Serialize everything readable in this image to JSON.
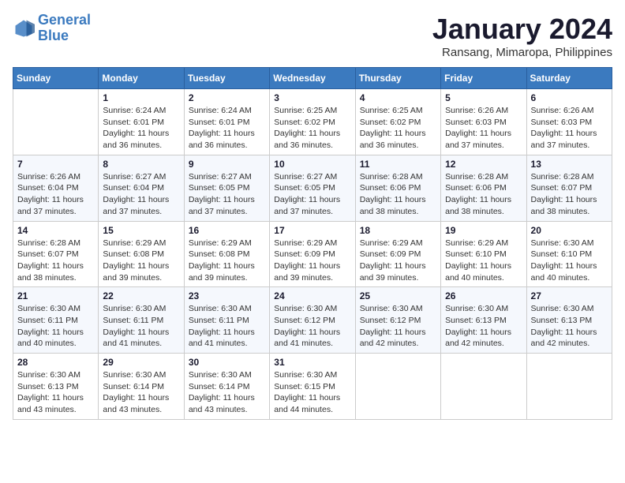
{
  "header": {
    "logo_line1": "General",
    "logo_line2": "Blue",
    "month": "January 2024",
    "location": "Ransang, Mimaropa, Philippines"
  },
  "weekdays": [
    "Sunday",
    "Monday",
    "Tuesday",
    "Wednesday",
    "Thursday",
    "Friday",
    "Saturday"
  ],
  "weeks": [
    [
      {
        "day": "",
        "sunrise": "",
        "sunset": "",
        "daylight": ""
      },
      {
        "day": "1",
        "sunrise": "Sunrise: 6:24 AM",
        "sunset": "Sunset: 6:01 PM",
        "daylight": "Daylight: 11 hours and 36 minutes."
      },
      {
        "day": "2",
        "sunrise": "Sunrise: 6:24 AM",
        "sunset": "Sunset: 6:01 PM",
        "daylight": "Daylight: 11 hours and 36 minutes."
      },
      {
        "day": "3",
        "sunrise": "Sunrise: 6:25 AM",
        "sunset": "Sunset: 6:02 PM",
        "daylight": "Daylight: 11 hours and 36 minutes."
      },
      {
        "day": "4",
        "sunrise": "Sunrise: 6:25 AM",
        "sunset": "Sunset: 6:02 PM",
        "daylight": "Daylight: 11 hours and 36 minutes."
      },
      {
        "day": "5",
        "sunrise": "Sunrise: 6:26 AM",
        "sunset": "Sunset: 6:03 PM",
        "daylight": "Daylight: 11 hours and 37 minutes."
      },
      {
        "day": "6",
        "sunrise": "Sunrise: 6:26 AM",
        "sunset": "Sunset: 6:03 PM",
        "daylight": "Daylight: 11 hours and 37 minutes."
      }
    ],
    [
      {
        "day": "7",
        "sunrise": "Sunrise: 6:26 AM",
        "sunset": "Sunset: 6:04 PM",
        "daylight": "Daylight: 11 hours and 37 minutes."
      },
      {
        "day": "8",
        "sunrise": "Sunrise: 6:27 AM",
        "sunset": "Sunset: 6:04 PM",
        "daylight": "Daylight: 11 hours and 37 minutes."
      },
      {
        "day": "9",
        "sunrise": "Sunrise: 6:27 AM",
        "sunset": "Sunset: 6:05 PM",
        "daylight": "Daylight: 11 hours and 37 minutes."
      },
      {
        "day": "10",
        "sunrise": "Sunrise: 6:27 AM",
        "sunset": "Sunset: 6:05 PM",
        "daylight": "Daylight: 11 hours and 37 minutes."
      },
      {
        "day": "11",
        "sunrise": "Sunrise: 6:28 AM",
        "sunset": "Sunset: 6:06 PM",
        "daylight": "Daylight: 11 hours and 38 minutes."
      },
      {
        "day": "12",
        "sunrise": "Sunrise: 6:28 AM",
        "sunset": "Sunset: 6:06 PM",
        "daylight": "Daylight: 11 hours and 38 minutes."
      },
      {
        "day": "13",
        "sunrise": "Sunrise: 6:28 AM",
        "sunset": "Sunset: 6:07 PM",
        "daylight": "Daylight: 11 hours and 38 minutes."
      }
    ],
    [
      {
        "day": "14",
        "sunrise": "Sunrise: 6:28 AM",
        "sunset": "Sunset: 6:07 PM",
        "daylight": "Daylight: 11 hours and 38 minutes."
      },
      {
        "day": "15",
        "sunrise": "Sunrise: 6:29 AM",
        "sunset": "Sunset: 6:08 PM",
        "daylight": "Daylight: 11 hours and 39 minutes."
      },
      {
        "day": "16",
        "sunrise": "Sunrise: 6:29 AM",
        "sunset": "Sunset: 6:08 PM",
        "daylight": "Daylight: 11 hours and 39 minutes."
      },
      {
        "day": "17",
        "sunrise": "Sunrise: 6:29 AM",
        "sunset": "Sunset: 6:09 PM",
        "daylight": "Daylight: 11 hours and 39 minutes."
      },
      {
        "day": "18",
        "sunrise": "Sunrise: 6:29 AM",
        "sunset": "Sunset: 6:09 PM",
        "daylight": "Daylight: 11 hours and 39 minutes."
      },
      {
        "day": "19",
        "sunrise": "Sunrise: 6:29 AM",
        "sunset": "Sunset: 6:10 PM",
        "daylight": "Daylight: 11 hours and 40 minutes."
      },
      {
        "day": "20",
        "sunrise": "Sunrise: 6:30 AM",
        "sunset": "Sunset: 6:10 PM",
        "daylight": "Daylight: 11 hours and 40 minutes."
      }
    ],
    [
      {
        "day": "21",
        "sunrise": "Sunrise: 6:30 AM",
        "sunset": "Sunset: 6:11 PM",
        "daylight": "Daylight: 11 hours and 40 minutes."
      },
      {
        "day": "22",
        "sunrise": "Sunrise: 6:30 AM",
        "sunset": "Sunset: 6:11 PM",
        "daylight": "Daylight: 11 hours and 41 minutes."
      },
      {
        "day": "23",
        "sunrise": "Sunrise: 6:30 AM",
        "sunset": "Sunset: 6:11 PM",
        "daylight": "Daylight: 11 hours and 41 minutes."
      },
      {
        "day": "24",
        "sunrise": "Sunrise: 6:30 AM",
        "sunset": "Sunset: 6:12 PM",
        "daylight": "Daylight: 11 hours and 41 minutes."
      },
      {
        "day": "25",
        "sunrise": "Sunrise: 6:30 AM",
        "sunset": "Sunset: 6:12 PM",
        "daylight": "Daylight: 11 hours and 42 minutes."
      },
      {
        "day": "26",
        "sunrise": "Sunrise: 6:30 AM",
        "sunset": "Sunset: 6:13 PM",
        "daylight": "Daylight: 11 hours and 42 minutes."
      },
      {
        "day": "27",
        "sunrise": "Sunrise: 6:30 AM",
        "sunset": "Sunset: 6:13 PM",
        "daylight": "Daylight: 11 hours and 42 minutes."
      }
    ],
    [
      {
        "day": "28",
        "sunrise": "Sunrise: 6:30 AM",
        "sunset": "Sunset: 6:13 PM",
        "daylight": "Daylight: 11 hours and 43 minutes."
      },
      {
        "day": "29",
        "sunrise": "Sunrise: 6:30 AM",
        "sunset": "Sunset: 6:14 PM",
        "daylight": "Daylight: 11 hours and 43 minutes."
      },
      {
        "day": "30",
        "sunrise": "Sunrise: 6:30 AM",
        "sunset": "Sunset: 6:14 PM",
        "daylight": "Daylight: 11 hours and 43 minutes."
      },
      {
        "day": "31",
        "sunrise": "Sunrise: 6:30 AM",
        "sunset": "Sunset: 6:15 PM",
        "daylight": "Daylight: 11 hours and 44 minutes."
      },
      {
        "day": "",
        "sunrise": "",
        "sunset": "",
        "daylight": ""
      },
      {
        "day": "",
        "sunrise": "",
        "sunset": "",
        "daylight": ""
      },
      {
        "day": "",
        "sunrise": "",
        "sunset": "",
        "daylight": ""
      }
    ]
  ]
}
